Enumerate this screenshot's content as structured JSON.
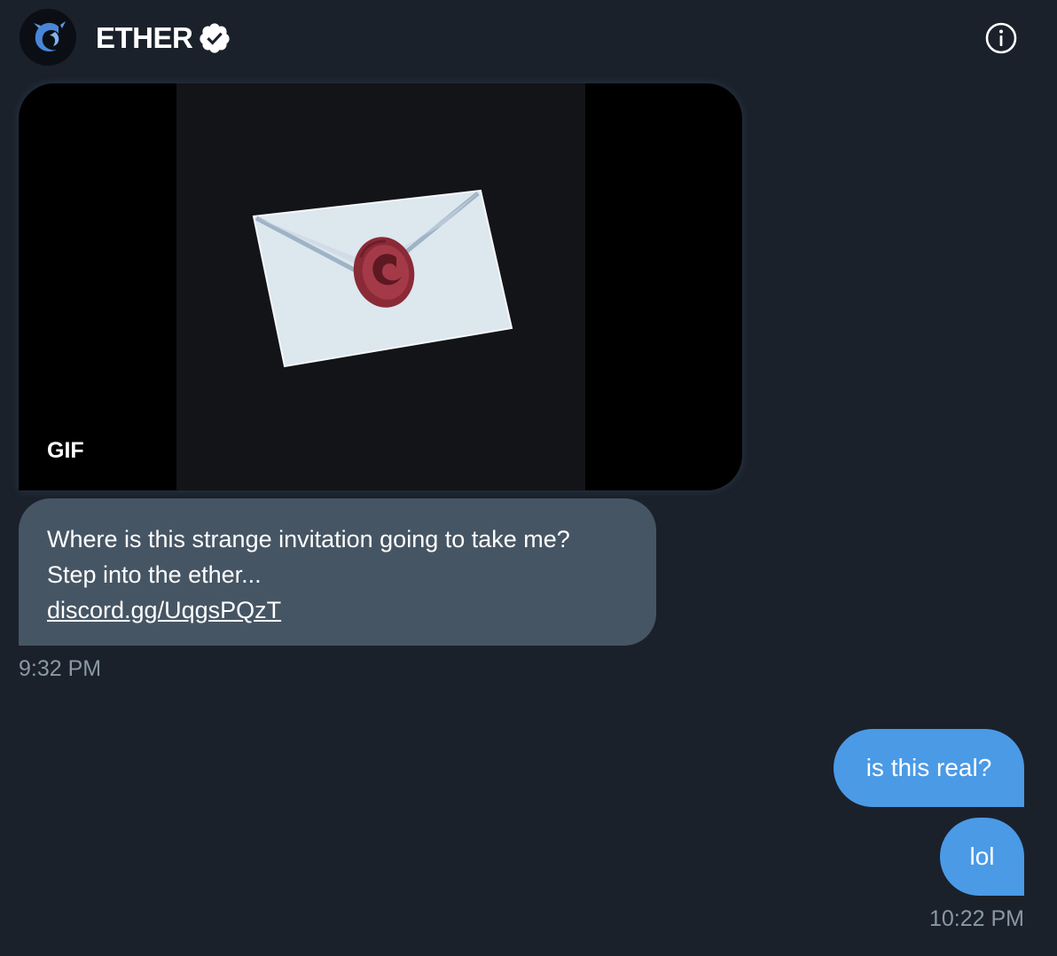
{
  "header": {
    "title": "ETHER",
    "verified": true,
    "info_icon": "info-circle-icon",
    "avatar_icon": "dragon-logo-icon"
  },
  "messages": [
    {
      "direction": "incoming",
      "media": {
        "type": "gif",
        "badge": "GIF",
        "subject": "envelope-with-red-wax-seal"
      },
      "lines": [
        "Where is this strange invitation going to take me?",
        "Step into the ether..."
      ],
      "link": "discord.gg/UqgsPQzT",
      "timestamp": "9:32 PM"
    },
    {
      "direction": "outgoing",
      "text": "is this real?"
    },
    {
      "direction": "outgoing",
      "text": "lol",
      "timestamp": "10:22 PM"
    }
  ],
  "colors": {
    "background": "#1a212b",
    "incoming_bubble": "#465564",
    "outgoing_bubble": "#4b9ae6",
    "timestamp": "#8b98a5",
    "verified_badge": "#ffffff"
  }
}
